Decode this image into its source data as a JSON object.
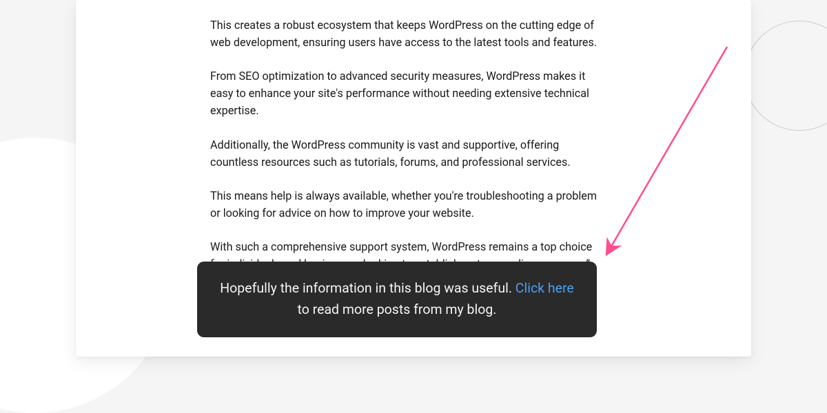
{
  "article": {
    "paragraphs": [
      "This creates a robust ecosystem that keeps WordPress on the cutting edge of web development, ensuring users have access to the latest tools and features.",
      "From SEO optimization to advanced security measures, WordPress makes it easy to enhance your site's performance without needing extensive technical expertise.",
      "Additionally, the WordPress community is vast and supportive, offering countless resources such as tutorials, forums, and professional services.",
      "This means help is always available, whether you're troubleshooting a problem or looking for advice on how to improve your website.",
      "With such a comprehensive support system, WordPress remains a top choice for individuals and businesses looking to establish a strong online presence.”"
    ]
  },
  "cta": {
    "text_before": "Hopefully the information in this blog was useful. ",
    "link_text": "Click here",
    "text_after": " to read more posts from my blog."
  },
  "annotation": {
    "type": "arrow",
    "color": "#ff4d8d"
  }
}
